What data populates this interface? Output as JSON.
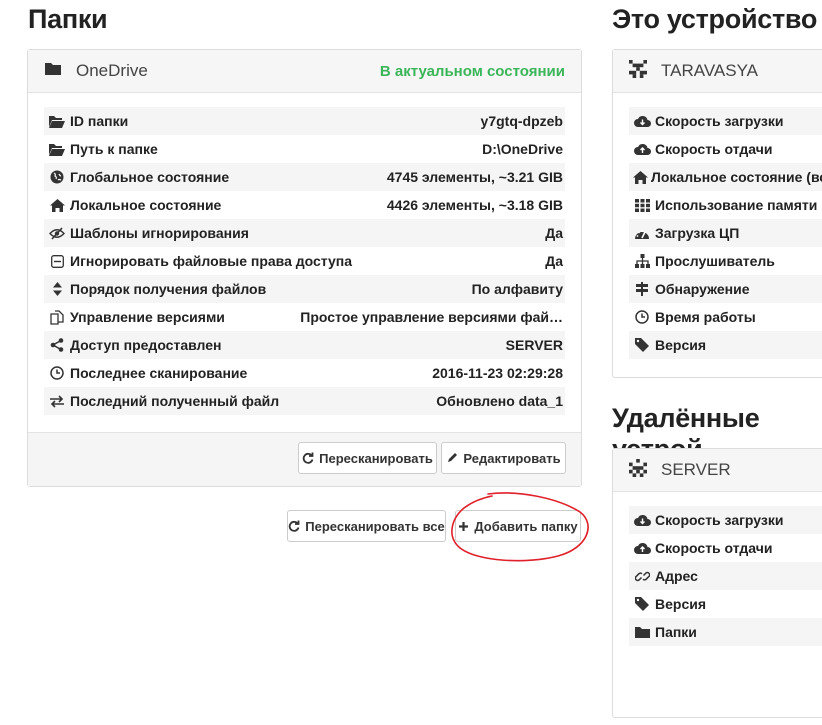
{
  "folders": {
    "heading": "Папки",
    "panel": {
      "name": "OneDrive",
      "status": "В актуальном состоянии",
      "rows": [
        {
          "icon": "folder-open-icon",
          "label": "ID папки",
          "value": "y7gtq-dpzeb"
        },
        {
          "icon": "folder-open-icon",
          "label": "Путь к папке",
          "value": "D:\\OneDrive"
        },
        {
          "icon": "globe-icon",
          "label": "Глобальное состояние",
          "value": "4745 элементы, ~3.21 GIB"
        },
        {
          "icon": "home-icon",
          "label": "Локальное состояние",
          "value": "4426 элементы, ~3.18 GIB"
        },
        {
          "icon": "eye-slash-icon",
          "label": "Шаблоны игнорирования",
          "value": "Да"
        },
        {
          "icon": "minus-square-icon",
          "label": "Игнорировать файловые права доступа",
          "value": "Да"
        },
        {
          "icon": "sort-icon",
          "label": "Порядок получения файлов",
          "value": "По алфавиту"
        },
        {
          "icon": "copy-icon",
          "label": "Управление версиями",
          "value": "Простое управление версиями фай…"
        },
        {
          "icon": "share-icon",
          "label": "Доступ предоставлен",
          "value": "SERVER"
        },
        {
          "icon": "clock-icon",
          "label": "Последнее сканирование",
          "value": "2016-11-23 02:29:28"
        },
        {
          "icon": "exchange-icon",
          "label": "Последний полученный файл",
          "value": "Обновлено data_1"
        }
      ],
      "rescan_label": "Пересканировать",
      "edit_label": "Редактировать"
    },
    "rescan_all_label": "Пересканировать все",
    "add_folder_label": "Добавить папку"
  },
  "this_device": {
    "heading": "Это устройство",
    "name": "TARAVASYA",
    "rows": [
      {
        "icon": "cloud-download-icon",
        "label": "Скорость загрузки"
      },
      {
        "icon": "cloud-upload-icon",
        "label": "Скорость отдачи"
      },
      {
        "icon": "home-icon",
        "label": "Локальное состояние (вс"
      },
      {
        "icon": "th-icon",
        "label": "Использование памяти"
      },
      {
        "icon": "dashboard-icon",
        "label": "Загрузка ЦП"
      },
      {
        "icon": "sitemap-icon",
        "label": "Прослушиватель"
      },
      {
        "icon": "signpost-icon",
        "label": "Обнаружение"
      },
      {
        "icon": "clock-icon",
        "label": "Время работы"
      },
      {
        "icon": "tag-icon",
        "label": "Версия"
      }
    ]
  },
  "remote_devices": {
    "heading": "Удалённые устрой",
    "name": "SERVER",
    "rows": [
      {
        "icon": "cloud-download-icon",
        "label": "Скорость загрузки"
      },
      {
        "icon": "cloud-upload-icon",
        "label": "Скорость отдачи"
      },
      {
        "icon": "link-icon",
        "label": "Адрес"
      },
      {
        "icon": "tag-icon",
        "label": "Версия"
      },
      {
        "icon": "folder-icon",
        "label": "Папки"
      }
    ]
  },
  "colors": {
    "status_green": "#3bb55a",
    "annotation_red": "#e0202a"
  }
}
